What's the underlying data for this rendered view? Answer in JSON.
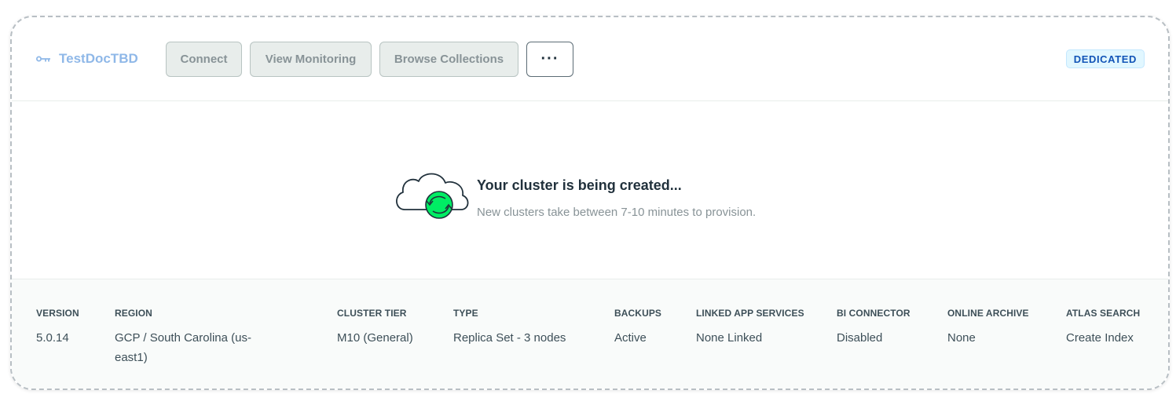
{
  "cluster": {
    "name": "TestDocTBD",
    "name_icon": "connector-icon",
    "badge": "DEDICATED"
  },
  "buttons": {
    "connect": "Connect",
    "view_monitoring": "View Monitoring",
    "browse_collections": "Browse Collections",
    "more": "···"
  },
  "status": {
    "icon": "cloud-sync-icon",
    "title": "Your cluster is being created...",
    "subtitle": "New clusters take between 7-10 minutes to provision."
  },
  "stats": {
    "version": {
      "label": "VERSION",
      "value": "5.0.14"
    },
    "region": {
      "label": "REGION",
      "value": "GCP / South Carolina (us-east1)"
    },
    "tier": {
      "label": "CLUSTER TIER",
      "value": "M10 (General)"
    },
    "type": {
      "label": "TYPE",
      "value": "Replica Set - 3 nodes"
    },
    "backups": {
      "label": "BACKUPS",
      "value": "Active"
    },
    "app_services": {
      "label": "LINKED APP SERVICES",
      "value": "None Linked"
    },
    "bi_connector": {
      "label": "BI CONNECTOR",
      "value": "Disabled"
    },
    "online_archive": {
      "label": "ONLINE ARCHIVE",
      "value": "None"
    },
    "atlas_search": {
      "label": "ATLAS SEARCH",
      "value": "Create Index"
    }
  },
  "colors": {
    "name_link": "#8fb8e8",
    "badge_text": "#1254b7",
    "badge_bg": "#e1f7ff",
    "sync_green": "#00ed64"
  }
}
